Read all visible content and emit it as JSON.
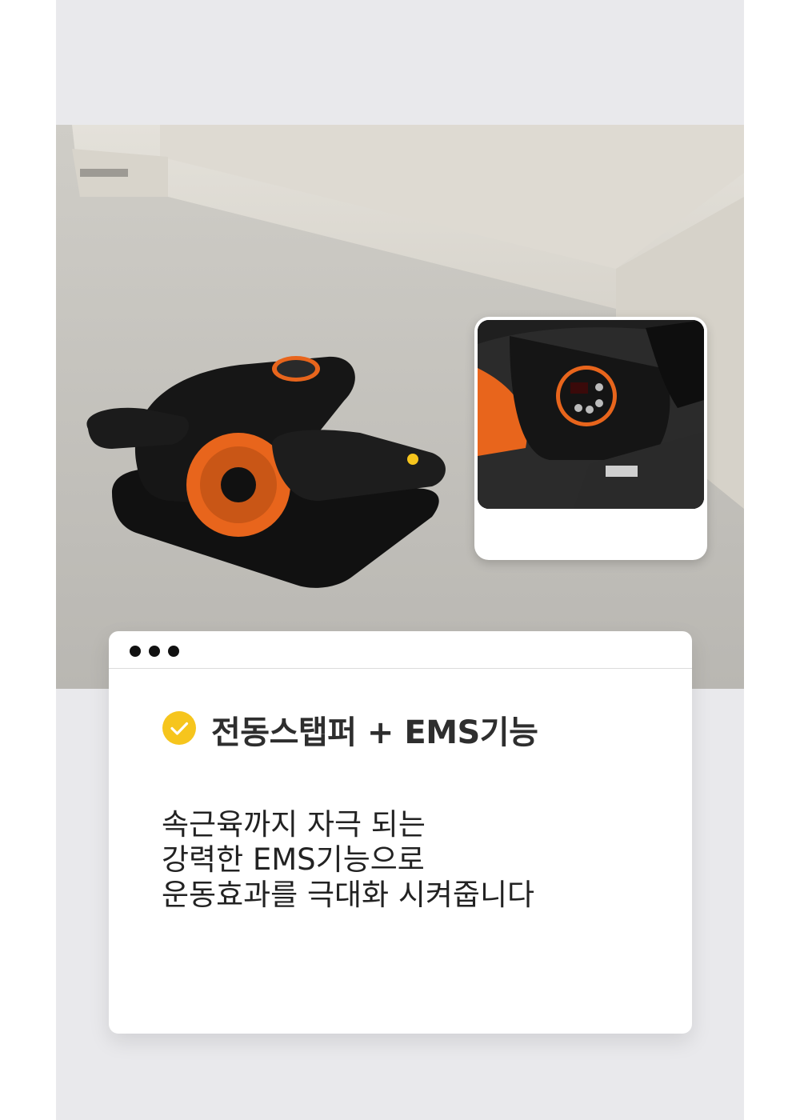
{
  "feature": {
    "title": "전동스탭퍼 + EMS기능",
    "description_lines": [
      "속근육까지 자극 되는",
      "강력한 EMS기능으로",
      "운동효과를 극대화 시켜줍니다"
    ]
  },
  "icons": {
    "check": "check-circle-icon",
    "window_dots": "window-dots-icon"
  },
  "colors": {
    "accent": "#f6c51d",
    "product_orange": "#e8651c",
    "panel_background": "#e9e9ec"
  }
}
